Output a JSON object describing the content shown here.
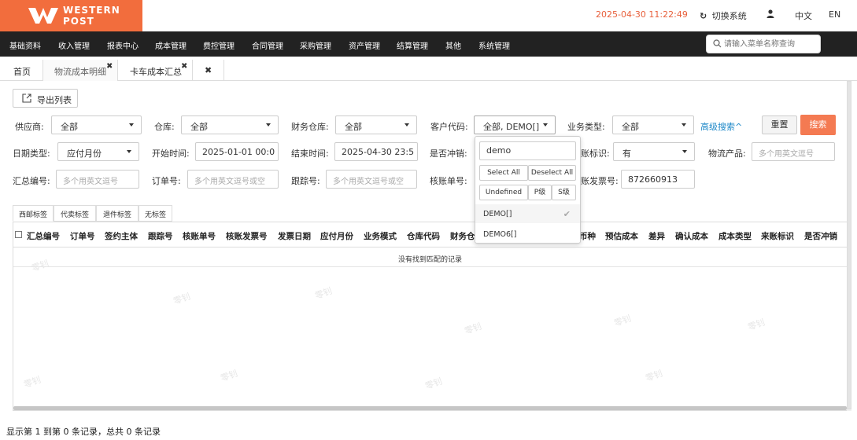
{
  "brand": {
    "line1": "WESTERN",
    "line2": "POST",
    "color": "#f26d3d"
  },
  "header": {
    "datetime": "2025-04-30 11:22:49",
    "switch_system": "切换系统",
    "lang_zh": "中文",
    "lang_en": "EN"
  },
  "nav": {
    "items": [
      "基础资料",
      "收入管理",
      "报表中心",
      "成本管理",
      "费控管理",
      "合同管理",
      "采购管理",
      "资产管理",
      "结算管理",
      "其他",
      "系统管理"
    ],
    "search_placeholder": "请输入菜单名称查询"
  },
  "page_tabs": [
    {
      "label": "首页",
      "closable": false
    },
    {
      "label": "物流成本明细",
      "closable": true
    },
    {
      "label": "卡车成本汇总",
      "closable": true
    }
  ],
  "toolbar": {
    "export_label": "导出列表"
  },
  "form": {
    "supplier": {
      "label": "供应商:",
      "value": "全部"
    },
    "warehouse": {
      "label": "仓库:",
      "value": "全部"
    },
    "finance_warehouse": {
      "label": "财务仓库:",
      "value": "全部"
    },
    "customer_code": {
      "label": "客户代码:",
      "value": "全部, DEMO[]"
    },
    "business_type": {
      "label": "业务类型:",
      "value": "全部"
    },
    "advanced_search": "高级搜索^",
    "reset": "重置",
    "search": "搜索",
    "date_type": {
      "label": "日期类型:",
      "value": "应付月份"
    },
    "start_time": {
      "label": "开始时间:",
      "value": "2025-01-01 00:0"
    },
    "end_time": {
      "label": "结束时间:",
      "value": "2025-04-30 23:5"
    },
    "is_offset": {
      "label": "是否冲销:"
    },
    "bill_flag": {
      "label": "账标识:",
      "value": "有"
    },
    "logistics_product": {
      "label": "物流产品:",
      "placeholder": "多个用英文逗号"
    },
    "summary_no": {
      "label": "汇总编号:",
      "placeholder": "多个用英文逗号"
    },
    "order_no": {
      "label": "订单号:",
      "placeholder": "多个用英文逗号或空"
    },
    "tracking_no": {
      "label": "跟踪号:",
      "placeholder": "多个用英文逗号或空"
    },
    "verify_no": {
      "label": "核账单号:"
    },
    "invoice_no": {
      "label": "账发票号:",
      "value": "872660913"
    }
  },
  "sub_tabs": [
    "西邮标签",
    "代卖标签",
    "退件标签",
    "无标签"
  ],
  "table": {
    "columns": [
      "汇总编号",
      "订单号",
      "签约主体",
      "跟踪号",
      "核账单号",
      "核账发票号",
      "发票日期",
      "应付月份",
      "业务模式",
      "仓库代码",
      "财务仓",
      "币种",
      "预估成本",
      "差异",
      "确认成本",
      "成本类型",
      "来账标识",
      "是否冲销"
    ],
    "empty_text": "没有找到匹配的记录"
  },
  "footer": {
    "info": "显示第 1 到第 0 条记录，总共 0 条记录"
  },
  "dropdown": {
    "search_value": "demo",
    "select_all": "Select All",
    "deselect_all": "Deselect All",
    "groups": [
      "Undefined",
      "P级",
      "S级"
    ],
    "options": [
      {
        "label": "DEMO[]",
        "selected": true
      },
      {
        "label": "DEMO6[]",
        "selected": false
      }
    ]
  },
  "watermark": "零钊",
  "colors": {
    "accent": "#f47a52",
    "link": "#1e88c8",
    "nav_bg": "#222222",
    "time": "#e8603c"
  }
}
